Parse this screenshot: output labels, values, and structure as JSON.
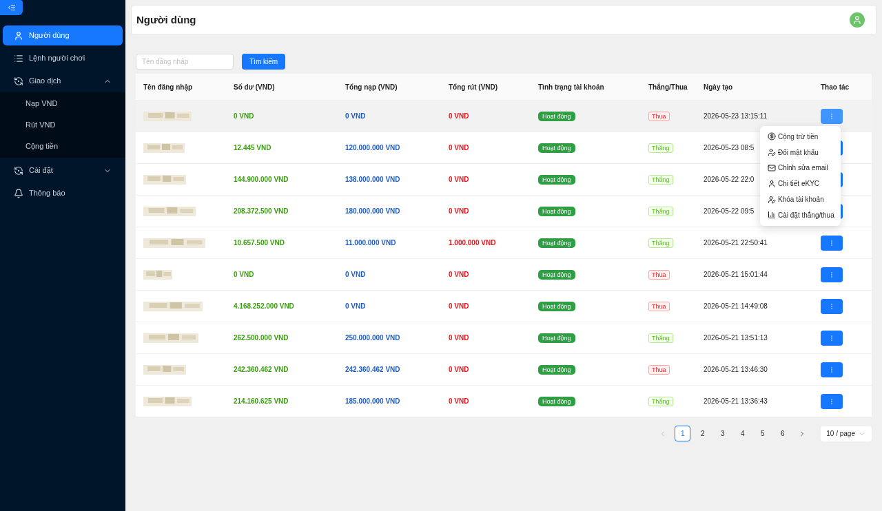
{
  "sidebar": {
    "items": [
      {
        "label": "Người dùng",
        "selected": true
      },
      {
        "label": "Lệnh người chơi",
        "selected": false
      },
      {
        "label": "Giao dịch",
        "selected": false,
        "expanded": true,
        "children": [
          {
            "label": "Nạp VND",
            "selected": false
          },
          {
            "label": "Rút VND",
            "selected": false
          },
          {
            "label": "Cộng tiền",
            "selected": false
          }
        ]
      },
      {
        "label": "Cài đặt",
        "selected": false,
        "expanded": false
      },
      {
        "label": "Thông báo",
        "selected": false
      }
    ]
  },
  "header": {
    "title": "Người dùng"
  },
  "search": {
    "placeholder": "Tên đăng nhập",
    "button": "Tìm kiếm"
  },
  "table": {
    "columns": [
      "Tên đăng nhập",
      "Số dư (VND)",
      "Tổng nạp (VND)",
      "Tổng rút (VND)",
      "Tình trạng tài khoản",
      "Thắng/Thua",
      "Ngày tạo",
      "Thao tác"
    ],
    "rows": [
      {
        "balance": "0 VND",
        "deposit": "0 VND",
        "withdraw": "0 VND",
        "status": "Hoạt động",
        "result": "Thua",
        "kind": "loss",
        "created": "2026-05-23 13:15:11",
        "highlighted": true
      },
      {
        "balance": "12.445 VND",
        "deposit": "120.000.000 VND",
        "withdraw": "0 VND",
        "status": "Hoạt động",
        "result": "Thắng",
        "kind": "win",
        "created": "2026-05-23 08:5",
        "highlighted": false
      },
      {
        "balance": "144.900.000 VND",
        "deposit": "138.000.000 VND",
        "withdraw": "0 VND",
        "status": "Hoạt động",
        "result": "Thắng",
        "kind": "win",
        "created": "2026-05-22 22:0",
        "highlighted": false
      },
      {
        "balance": "208.372.500 VND",
        "deposit": "180.000.000 VND",
        "withdraw": "0 VND",
        "status": "Hoạt động",
        "result": "Thắng",
        "kind": "win",
        "created": "2026-05-22 09:5",
        "highlighted": false
      },
      {
        "balance": "10.657.500 VND",
        "deposit": "11.000.000 VND",
        "withdraw": "1.000.000 VND",
        "status": "Hoạt động",
        "result": "Thắng",
        "kind": "win",
        "created": "2026-05-21 22:50:41",
        "highlighted": false
      },
      {
        "balance": "0 VND",
        "deposit": "0 VND",
        "withdraw": "0 VND",
        "status": "Hoạt động",
        "result": "Thua",
        "kind": "loss",
        "created": "2026-05-21 15:01:44",
        "highlighted": false
      },
      {
        "balance": "4.168.252.000 VND",
        "deposit": "0 VND",
        "withdraw": "0 VND",
        "status": "Hoạt động",
        "result": "Thua",
        "kind": "loss",
        "created": "2026-05-21 14:49:08",
        "highlighted": false
      },
      {
        "balance": "262.500.000 VND",
        "deposit": "250.000.000 VND",
        "withdraw": "0 VND",
        "status": "Hoạt động",
        "result": "Thắng",
        "kind": "win",
        "created": "2026-05-21 13:51:13",
        "highlighted": false
      },
      {
        "balance": "242.360.462 VND",
        "deposit": "242.360.462 VND",
        "withdraw": "0 VND",
        "status": "Hoạt động",
        "result": "Thua",
        "kind": "loss",
        "created": "2026-05-21 13:46:30",
        "highlighted": false
      },
      {
        "balance": "214.160.625 VND",
        "deposit": "185.000.000 VND",
        "withdraw": "0 VND",
        "status": "Hoạt động",
        "result": "Thắng",
        "kind": "win",
        "created": "2026-05-21 13:36:43",
        "highlighted": false
      }
    ]
  },
  "action_menu": {
    "items": [
      {
        "label": "Cộng trừ tiền"
      },
      {
        "label": "Đổi mật khẩu"
      },
      {
        "label": "Chỉnh sửa email"
      },
      {
        "label": "Chi tiết eKYC"
      },
      {
        "label": "Khóa tài khoản"
      },
      {
        "label": "Cài đặt thắng/thua"
      }
    ]
  },
  "pagination": {
    "pages": [
      {
        "label": "1",
        "selected": true
      },
      {
        "label": "2",
        "selected": false
      },
      {
        "label": "3",
        "selected": false
      },
      {
        "label": "4",
        "selected": false
      },
      {
        "label": "5",
        "selected": false
      },
      {
        "label": "6",
        "selected": false
      }
    ],
    "page_size": "10 / page"
  }
}
